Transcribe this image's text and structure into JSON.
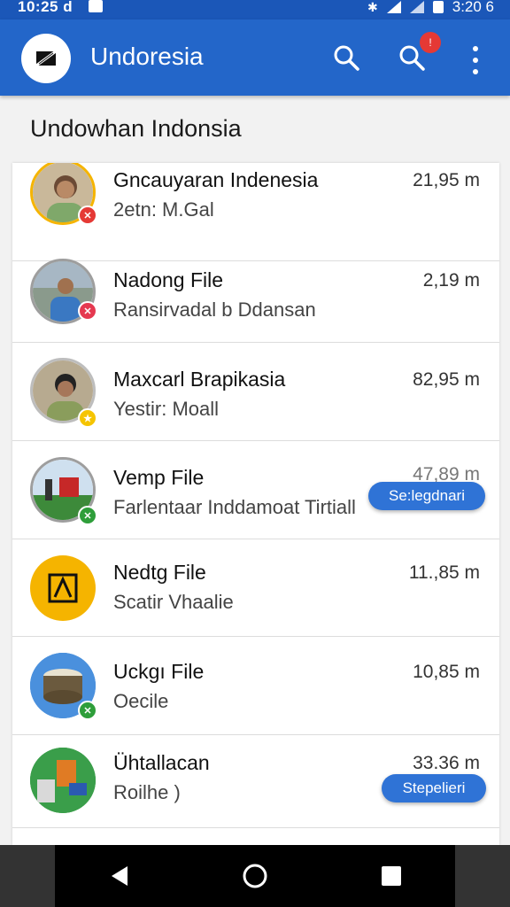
{
  "status_bar": {
    "time": "10:25 d",
    "clock": "3:20 6",
    "icons": [
      "notification-icon",
      "bluetooth-icon",
      "wifi-icon",
      "signal-icon",
      "battery-icon"
    ]
  },
  "app_bar": {
    "title": "Undoresia",
    "logo_icon": "app-logo-icon",
    "actions": [
      "search-icon",
      "notifications-search-icon",
      "more-vert-icon"
    ],
    "badge": "!"
  },
  "section_title": "Undowhan Indonsia",
  "files": [
    {
      "title": "Gncauyaran Indenesia",
      "subtitle": "2etn: M.Gal",
      "size": "21,95 m",
      "avatar": "person-photo",
      "mini_icon": "tool-icon",
      "mini_color": "#e53935",
      "ring": "#f5b400"
    },
    {
      "title": "Nadong File",
      "subtitle": "Ransirvadal b Ddansan",
      "size": "2,19 m",
      "avatar": "person-photo",
      "mini_icon": "tool-icon",
      "mini_color": "#e53950",
      "ring": "#9e9e9e"
    },
    {
      "title": "Maxcarl Brapikasia",
      "subtitle": "Yestir: Moall",
      "size": "82,95 m",
      "avatar": "person-photo",
      "mini_icon": "star-icon",
      "mini_color": "#f5c400",
      "ring": "#bdbdbd"
    },
    {
      "title": "Vemp File",
      "subtitle": "Farlentaar Inddamoat Tirtiall",
      "size": "47,89 m",
      "avatar": "landscape-photo",
      "mini_icon": "tool-icon",
      "mini_color": "#2e9e3a",
      "ring": "#9e9e9e",
      "action": "Se:legdnari"
    },
    {
      "title": "Nedtg File",
      "subtitle": "Scatir Vhaalie",
      "size": "11.,85 m",
      "avatar": "yellow-app-icon",
      "mini_icon": "",
      "mini_color": "",
      "ring": "#f5b400"
    },
    {
      "title": "Uckgı File",
      "subtitle": "Oecile",
      "size": "10,85 m",
      "avatar": "drum-photo",
      "mini_icon": "tool-icon",
      "mini_color": "#2e9e3a",
      "ring": "#3b87d9"
    },
    {
      "title": "Ühtallacan",
      "subtitle": "Roilhe )",
      "size": "33.36 m",
      "avatar": "package-photo",
      "mini_icon": "",
      "mini_color": "",
      "ring": "#2e9e3a",
      "action": "Stepelieri"
    }
  ],
  "nav_bar": {
    "buttons": [
      "back-icon",
      "home-icon",
      "recents-icon"
    ]
  }
}
